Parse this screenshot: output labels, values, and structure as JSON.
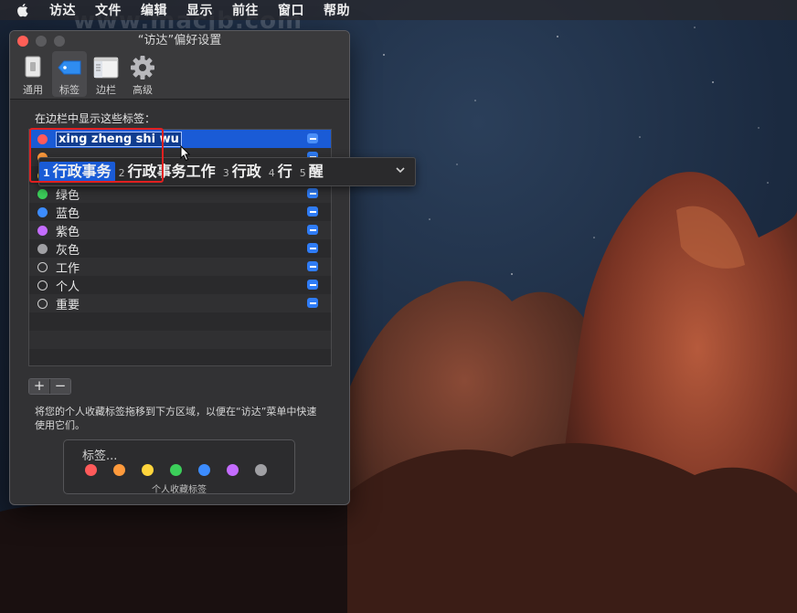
{
  "menubar": {
    "items": [
      "访达",
      "文件",
      "编辑",
      "显示",
      "前往",
      "窗口",
      "帮助"
    ]
  },
  "watermark": "www.macjb.com",
  "window": {
    "title": "“访达”偏好设置",
    "toolbar": [
      {
        "label": "通用",
        "icon": "general-switch-icon"
      },
      {
        "label": "标签",
        "icon": "tag-icon"
      },
      {
        "label": "边栏",
        "icon": "sidebar-icon"
      },
      {
        "label": "高级",
        "icon": "gear-icon"
      }
    ],
    "selected_tab": "标签",
    "list_heading": "在边栏中显示这些标签：",
    "tags": [
      {
        "name": "xing zheng shi wu",
        "color": "#ff5a5a",
        "editing": true
      },
      {
        "name": "",
        "color": "#ff9a3c"
      },
      {
        "name": "",
        "color": "#ffd53c"
      },
      {
        "name": "绿色",
        "color": "#3ccf5a"
      },
      {
        "name": "蓝色",
        "color": "#3c8cff"
      },
      {
        "name": "紫色",
        "color": "#c46cff"
      },
      {
        "name": "灰色",
        "color": "#a0a0a4"
      },
      {
        "name": "工作",
        "color": "none"
      },
      {
        "name": "个人",
        "color": "none"
      },
      {
        "name": "重要",
        "color": "none"
      }
    ],
    "add_label": "+",
    "remove_label": "−",
    "hint": "将您的个人收藏标签拖移到下方区域，以便在“访达”菜单中快速使用它们。",
    "favorites": {
      "title": "标签...",
      "label": "个人收藏标签",
      "colors": [
        "#ff5a5a",
        "#ff9a3c",
        "#ffd53c",
        "#3ccf5a",
        "#3c8cff",
        "#c46cff",
        "#a0a0a4"
      ]
    }
  },
  "ime": {
    "candidates": [
      {
        "num": "1",
        "text": "行政事务"
      },
      {
        "num": "2",
        "text": "行政事务工作"
      },
      {
        "num": "3",
        "text": "行政"
      },
      {
        "num": "4",
        "text": "行"
      },
      {
        "num": "5",
        "text": "醒"
      }
    ],
    "active_index": 0
  }
}
